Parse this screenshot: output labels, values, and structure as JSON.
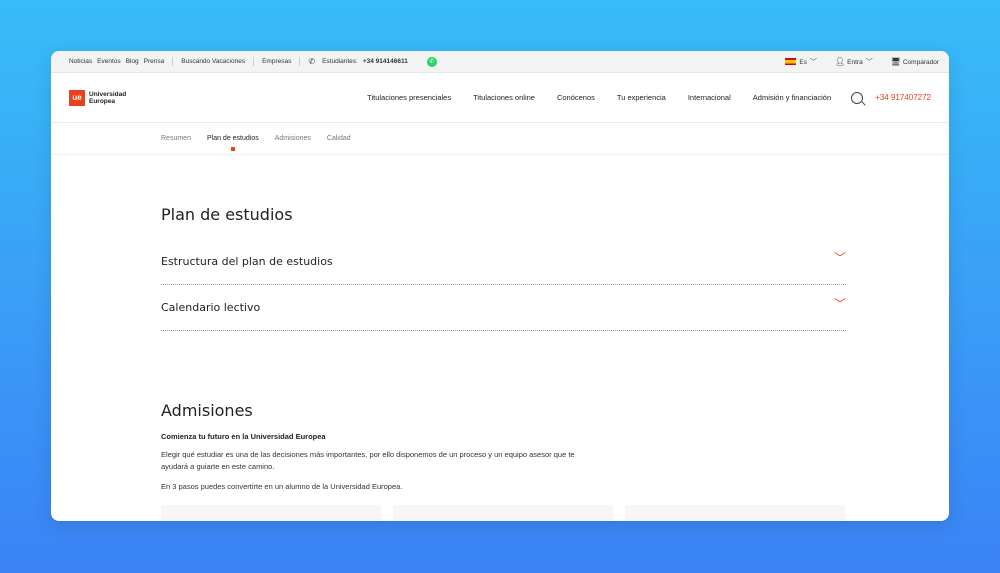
{
  "topbar": {
    "links": [
      "Noticias",
      "Eventos",
      "Blog",
      "Prensa"
    ],
    "vacaciones": "Buscando Vacaciones",
    "empresas": "Empresas",
    "estudiantes_label": "Estudiantes:",
    "estudiantes_phone": "+34 914146611",
    "lang": "Es",
    "login": "Entra",
    "compare": "Comparador"
  },
  "logo": {
    "line1": "Universidad",
    "line2": "Europea",
    "mark": "ue"
  },
  "nav": {
    "items": [
      "Titulaciones presenciales",
      "Titulaciones online",
      "Conócenos",
      "Tu experiencia",
      "Internacional",
      "Admisión y financiación"
    ],
    "phone": "+34 917407272"
  },
  "subnav": {
    "tabs": [
      "Resumen",
      "Plan de estudios",
      "Admisiones",
      "Calidad"
    ],
    "active": "Plan de estudios"
  },
  "plan": {
    "title": "Plan de estudios",
    "accordion": [
      "Estructura del plan de estudios",
      "Calendario lectivo"
    ]
  },
  "admisiones": {
    "title": "Admisiones",
    "subtitle": "Comienza tu futuro en la Universidad Europea",
    "p1": "Elegir qué estudiar es una de las decisiones más importantes, por ello disponemos de un proceso y un equipo asesor que te ayudará a guiarte en este camino.",
    "p2": "En 3 pasos puedes convertirte en un alumno de la Universidad Europea."
  },
  "colors": {
    "accent": "#e8411c",
    "bg_top": "#38bdf8",
    "bg_bottom": "#3b82f6"
  }
}
